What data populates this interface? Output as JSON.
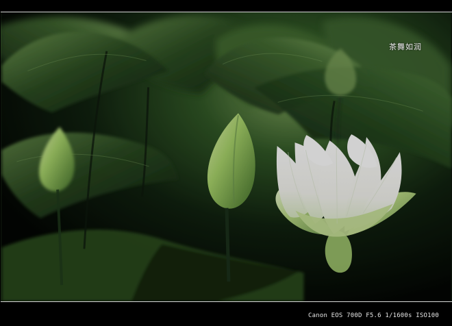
{
  "photo": {
    "subject": "white-lotus-flower",
    "accent_colors": {
      "background": "#000000",
      "leaf_dark": "#10210f",
      "leaf_mid": "#315826",
      "leaf_light": "#7da15b",
      "petal_white": "#f5f5ef",
      "petal_green": "#b8d783"
    }
  },
  "watermark": {
    "text": "茶舞如润"
  },
  "exif": {
    "text": "Canon EOS 700D F5.6 1/1600s ISO100"
  }
}
